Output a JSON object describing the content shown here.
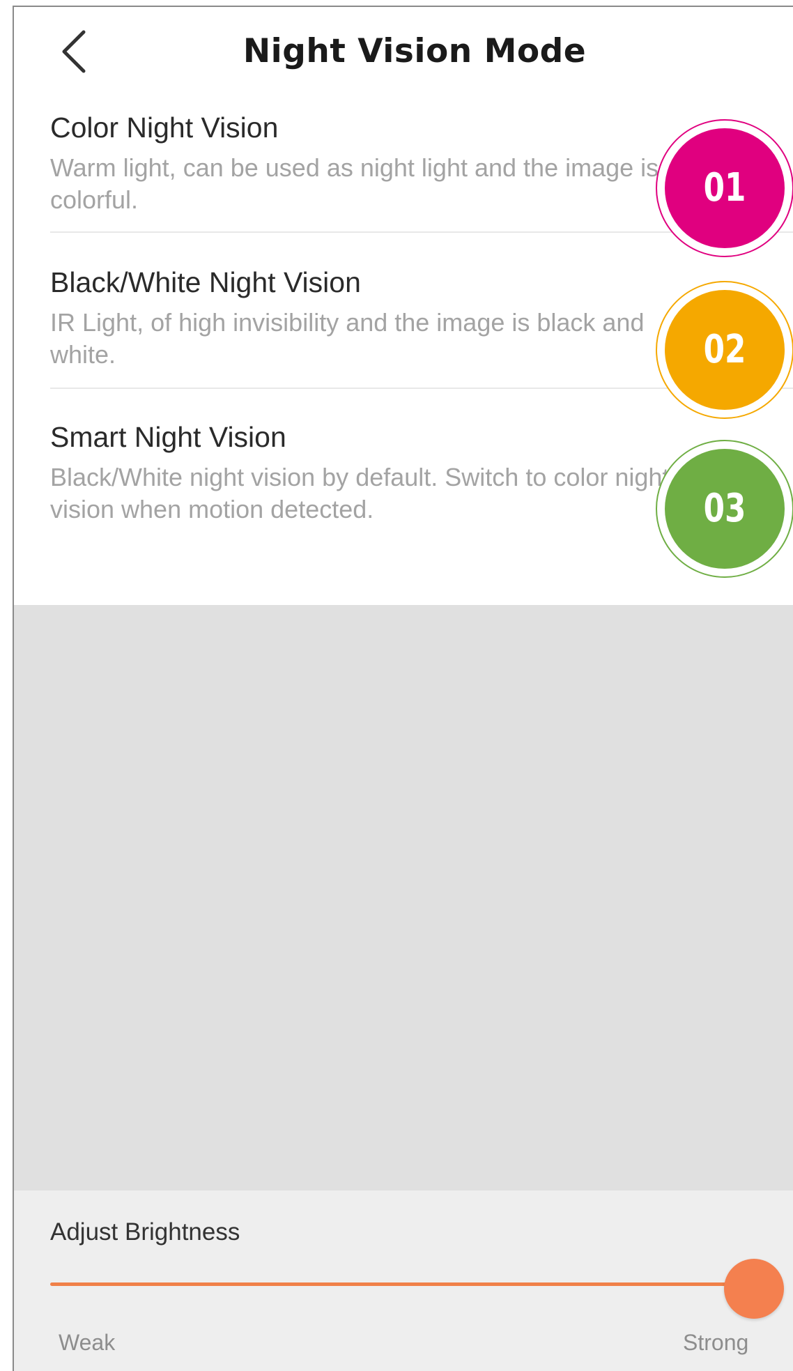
{
  "header": {
    "title": "Night Vision Mode",
    "back_icon": "chevron-left-icon"
  },
  "modes": [
    {
      "title": "Color Night Vision",
      "description": "Warm light, can be used as night light and the image is colorful."
    },
    {
      "title": "Black/White Night Vision",
      "description": "IR Light, of high invisibility and the image is black and white."
    },
    {
      "title": "Smart Night Vision",
      "description": "Black/White night vision by default. Switch to color night vision when motion detected."
    }
  ],
  "brightness": {
    "label": "Adjust Brightness",
    "min_label": "Weak",
    "max_label": "Strong",
    "value_fraction": 1.0
  },
  "badges": [
    {
      "label": "01",
      "color": "#e0007f"
    },
    {
      "label": "02",
      "color": "#f5a800"
    },
    {
      "label": "03",
      "color": "#6fae44"
    }
  ],
  "colors": {
    "accent": "#f4804f",
    "title_text": "#1a1a1a",
    "desc_text": "#a3a3a3",
    "background_gray": "#e0e0e0"
  }
}
